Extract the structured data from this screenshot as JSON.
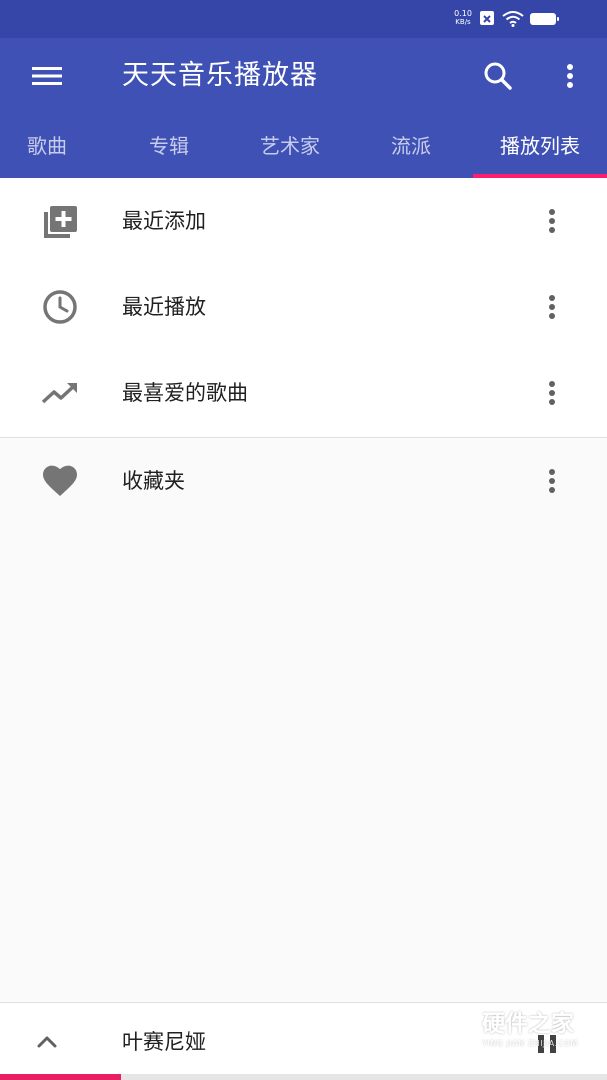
{
  "status_bar": {
    "speed_value": "0.10",
    "speed_unit": "KB/s",
    "colors": {
      "background": "#3646a8"
    }
  },
  "toolbar": {
    "title": "天天音乐播放器",
    "icons": [
      "menu-icon",
      "search-icon",
      "more-vert-icon"
    ],
    "colors": {
      "background": "#3f51b5",
      "text": "#ffffff"
    }
  },
  "tabs": {
    "items": [
      {
        "label": "歌曲"
      },
      {
        "label": "专辑"
      },
      {
        "label": "艺术家"
      },
      {
        "label": "流派"
      },
      {
        "label": "播放列表"
      }
    ],
    "active": "播放列表",
    "colors": {
      "indicator": "#ff1e6f"
    }
  },
  "playlists": [
    {
      "label": "最近添加",
      "icon": "playlist-add-icon"
    },
    {
      "label": "最近播放",
      "icon": "clock-icon"
    },
    {
      "label": "最喜爱的歌曲",
      "icon": "trending-up-icon"
    },
    {
      "label": "收藏夹",
      "icon": "heart-icon"
    }
  ],
  "player": {
    "song_title": "叶赛尼娅",
    "progress": 0.2,
    "colors": {
      "progress": "#e91e63"
    }
  },
  "watermark": {
    "text": "硬件之家",
    "sub": "YING JIAN ZHIJIA.COM"
  }
}
